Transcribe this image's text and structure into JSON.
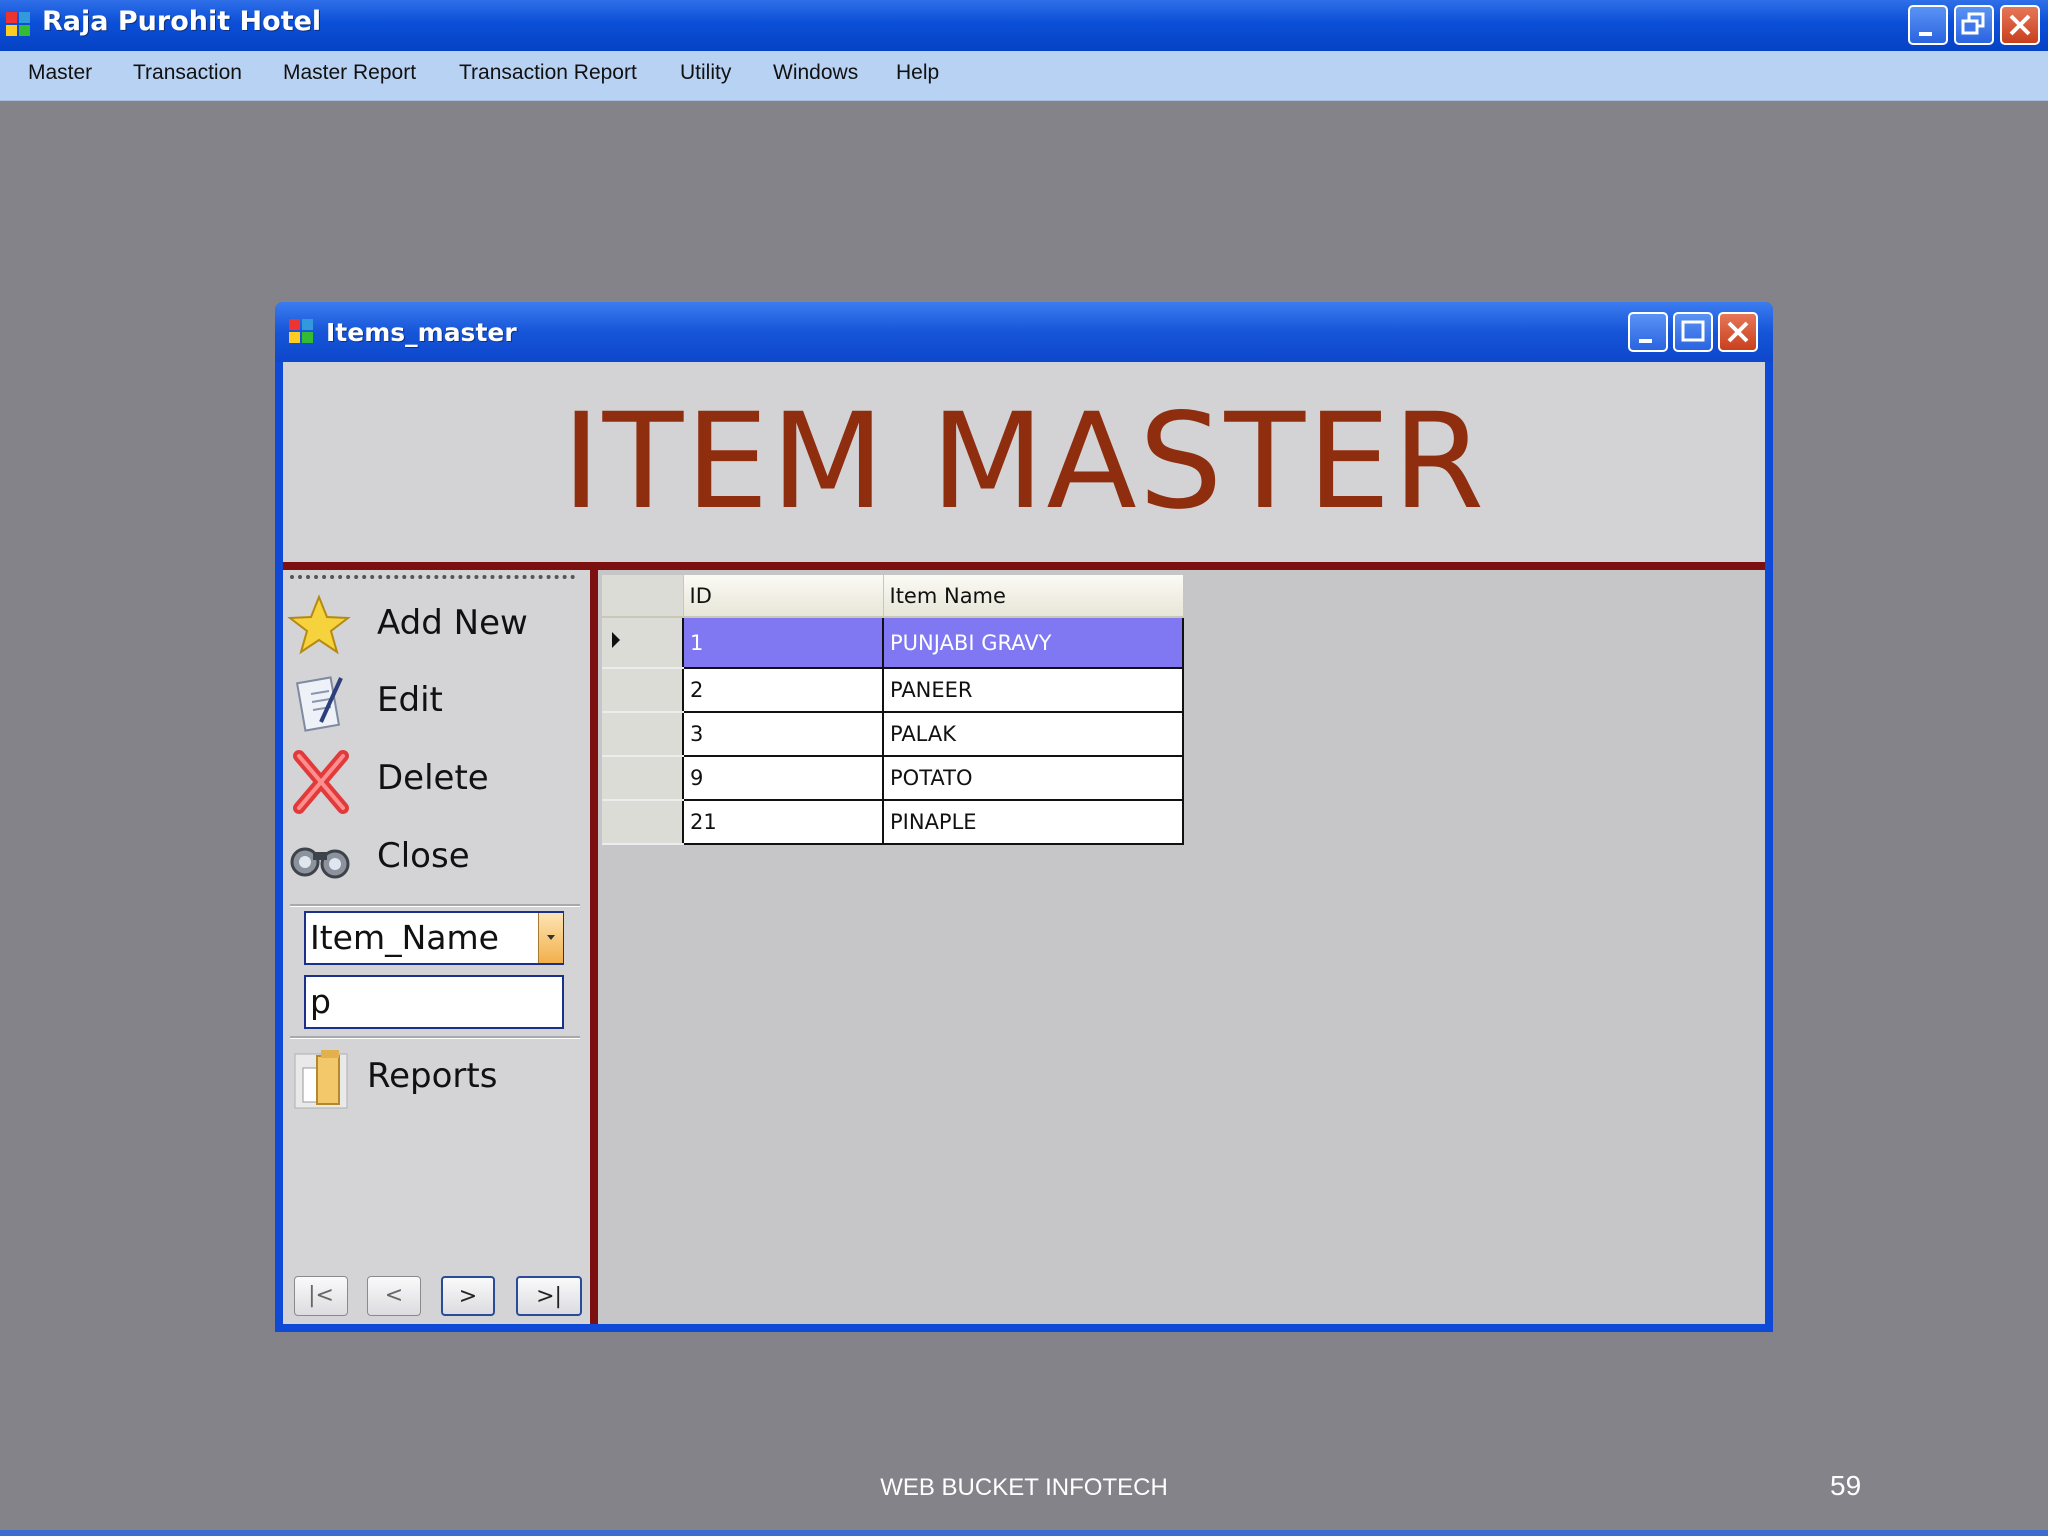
{
  "app": {
    "title": "Raja Purohit Hotel",
    "menu": [
      {
        "label": "Master",
        "accel": "M"
      },
      {
        "label": "Transaction",
        "accel": "T"
      },
      {
        "label": "Master Report",
        "accel": "M"
      },
      {
        "label": "Transaction Report",
        "accel": "T"
      },
      {
        "label": "Utility"
      },
      {
        "label": "Windows"
      },
      {
        "label": "Help"
      }
    ]
  },
  "child": {
    "title": "Items_master",
    "banner": "ITEM MASTER"
  },
  "toolbar": {
    "add_new": "Add New",
    "edit": "Edit",
    "delete": "Delete",
    "close": "Close",
    "reports": "Reports"
  },
  "search": {
    "field_selected": "Item_Name",
    "value": "p"
  },
  "nav": {
    "first": "|<",
    "prev": "<",
    "next": ">",
    "last": ">|"
  },
  "grid": {
    "columns": [
      "ID",
      "Item Name"
    ],
    "rows": [
      {
        "id": "1",
        "name": "PUNJABI GRAVY",
        "selected": true
      },
      {
        "id": "2",
        "name": "PANEER"
      },
      {
        "id": "3",
        "name": "PALAK"
      },
      {
        "id": "9",
        "name": "POTATO"
      },
      {
        "id": "21",
        "name": "PINAPLE"
      }
    ]
  },
  "slide": {
    "footer": "WEB BUCKET INFOTECH",
    "page": "59"
  },
  "colors": {
    "titlebar": "#0b4fd8",
    "banner_text": "#8f2d0f",
    "divider": "#7c1010",
    "selected_row": "#7f78f2"
  }
}
